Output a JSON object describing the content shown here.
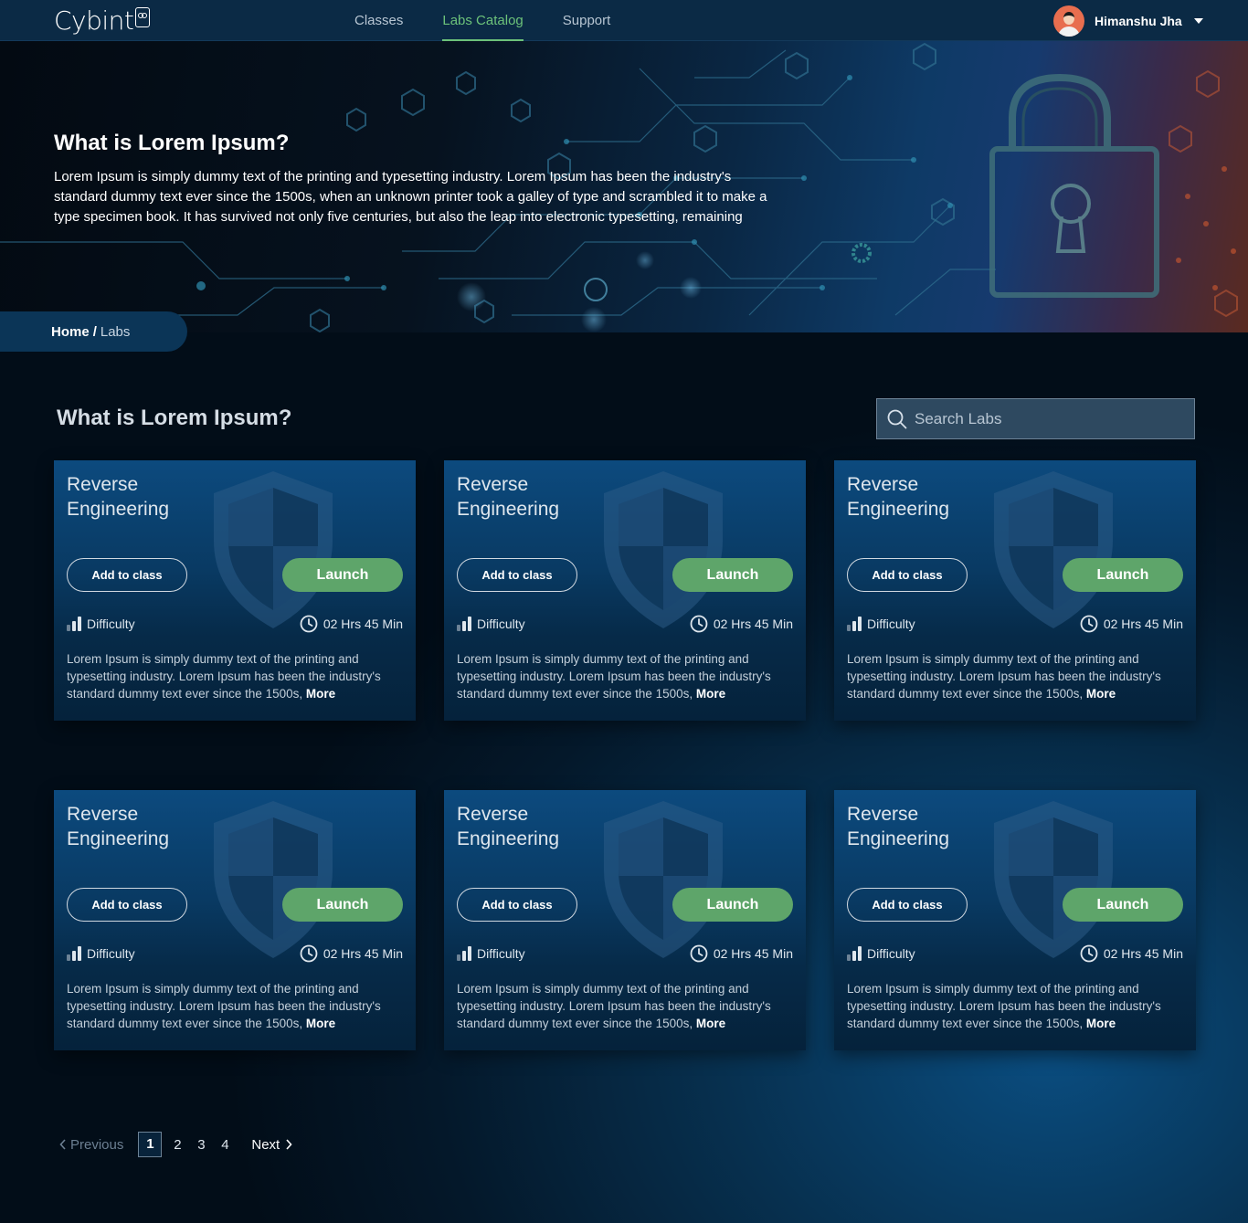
{
  "brand": {
    "logo_text": "Cybint"
  },
  "nav": {
    "links": [
      {
        "label": "Classes"
      },
      {
        "label": "Labs Catalog",
        "active": true
      },
      {
        "label": "Support"
      }
    ],
    "user_name": "Himanshu Jha"
  },
  "hero": {
    "title": "What is Lorem Ipsum?",
    "text": "Lorem Ipsum is simply dummy text of the printing and typesetting industry. Lorem Ipsum has been the industry's standard dummy text ever since the 1500s, when an unknown printer took a galley of type and scrambled it to make a type specimen book. It has survived not only five centuries, but also the leap into electronic typesetting, remaining"
  },
  "breadcrumb": {
    "home": "Home",
    "separator": "/",
    "current": "Labs"
  },
  "section": {
    "title": "What is Lorem Ipsum?"
  },
  "search": {
    "placeholder": "Search Labs",
    "value": ""
  },
  "cards": [
    {
      "title": "Reverse Engineering",
      "add_label": "Add to class",
      "launch_label": "Launch",
      "difficulty_label": "Difficulty",
      "duration": "02 Hrs 45 Min",
      "description": "Lorem Ipsum is simply dummy text of the printing and typesetting industry. Lorem Ipsum has been the industry's standard dummy text ever since the 1500s,",
      "more_label": "More"
    },
    {
      "title": "Reverse Engineering",
      "add_label": "Add to class",
      "launch_label": "Launch",
      "difficulty_label": "Difficulty",
      "duration": "02 Hrs 45 Min",
      "description": "Lorem Ipsum is simply dummy text of the printing and typesetting industry. Lorem Ipsum has been the industry's standard dummy text ever since the 1500s,",
      "more_label": "More"
    },
    {
      "title": "Reverse Engineering",
      "add_label": "Add to class",
      "launch_label": "Launch",
      "difficulty_label": "Difficulty",
      "duration": "02 Hrs 45 Min",
      "description": "Lorem Ipsum is simply dummy text of the printing and typesetting industry. Lorem Ipsum has been the industry's standard dummy text ever since the 1500s,",
      "more_label": "More"
    },
    {
      "title": "Reverse Engineering",
      "add_label": "Add to class",
      "launch_label": "Launch",
      "difficulty_label": "Difficulty",
      "duration": "02 Hrs 45 Min",
      "description": "Lorem Ipsum is simply dummy text of the printing and typesetting industry. Lorem Ipsum has been the industry's standard dummy text ever since the 1500s,",
      "more_label": "More"
    },
    {
      "title": "Reverse Engineering",
      "add_label": "Add to class",
      "launch_label": "Launch",
      "difficulty_label": "Difficulty",
      "duration": "02 Hrs 45 Min",
      "description": "Lorem Ipsum is simply dummy text of the printing and typesetting industry. Lorem Ipsum has been the industry's standard dummy text ever since the 1500s,",
      "more_label": "More"
    },
    {
      "title": "Reverse Engineering",
      "add_label": "Add to class",
      "launch_label": "Launch",
      "difficulty_label": "Difficulty",
      "duration": "02 Hrs 45 Min",
      "description": "Lorem Ipsum is simply dummy text of the printing and typesetting industry. Lorem Ipsum has been the industry's standard dummy text ever since the 1500s,",
      "more_label": "More"
    }
  ],
  "pagination": {
    "previous_label": "Previous",
    "next_label": "Next",
    "pages": [
      "1",
      "2",
      "3",
      "4"
    ],
    "current_page": "1"
  },
  "colors": {
    "accent_green": "#6cc27a",
    "launch_green": "#5ea56a",
    "nav_bg": "#0b2a45"
  },
  "icons": [
    "owl-icon",
    "caret-down-icon",
    "search-icon",
    "shield-icon",
    "difficulty-bars-icon",
    "clock-icon",
    "chevron-left-icon",
    "chevron-right-icon",
    "padlock-icon"
  ]
}
